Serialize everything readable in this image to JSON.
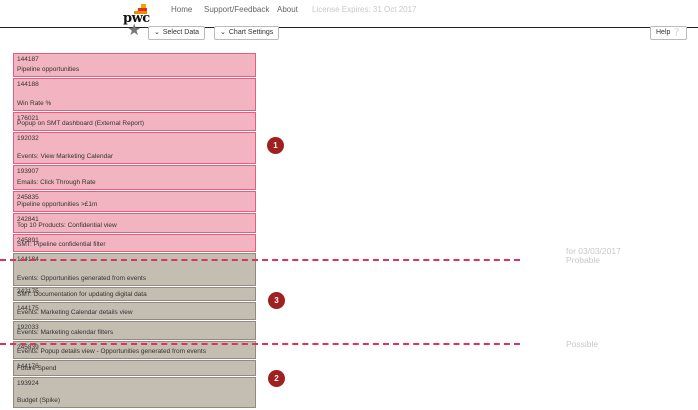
{
  "header": {
    "logo_text": "pwc",
    "nav": [
      "Home",
      "Support/Feedback",
      "About"
    ],
    "license": "License Expires: 31 Oct 2017"
  },
  "toolbar": {
    "select_data": "Select Data",
    "chart_settings": "Chart Settings",
    "help": "Help"
  },
  "items": [
    {
      "id": "144187",
      "name": "Pipeline opportunities",
      "status": "pink"
    },
    {
      "id": "144188",
      "name": "Win Rate %",
      "status": "pink"
    },
    {
      "id": "176021",
      "name": "Popup on SMT dashboard (External Report)",
      "status": "pink"
    },
    {
      "id": "192032",
      "name": "Events: View Marketing Calendar",
      "status": "pink"
    },
    {
      "id": "193907",
      "name": "Emails: Click Through Rate",
      "status": "pink"
    },
    {
      "id": "245835",
      "name": "Pipeline opportunities >£1m",
      "status": "pink"
    },
    {
      "id": "242841",
      "name": "Top 10 Products: Confidential view",
      "status": "pink"
    },
    {
      "id": "245891",
      "name": "SMT: Pipeline confidential filter",
      "status": "pink"
    },
    {
      "id": "144184",
      "name": "Events: Opportunities generated from events",
      "status": "gray"
    },
    {
      "id": "242175",
      "name": "SMT: Documentation for updating digital data",
      "status": "gray"
    },
    {
      "id": "144175",
      "name": "Events: Marketing Calendar details view",
      "status": "gray"
    },
    {
      "id": "192033",
      "name": "Events: Marketing calendar filters",
      "status": "gray"
    },
    {
      "id": "245839",
      "name": "Events: Popup details view - Opportunities generated from events",
      "status": "gray"
    },
    {
      "id": "144176",
      "name": "Future Spend",
      "status": "gray"
    },
    {
      "id": "193924",
      "name": "Budget (Spike)",
      "status": "gray"
    }
  ],
  "thresholds": {
    "probable_date": "for 03/03/2017",
    "probable_label": "Probable",
    "possible_label": "Possible"
  },
  "markers": [
    "1",
    "3",
    "2"
  ],
  "colors": {
    "committed": "#f2b4c0",
    "uncommitted": "#c4bdb1",
    "threshold_line": "#e0305e",
    "marker": "#a01f1f"
  }
}
